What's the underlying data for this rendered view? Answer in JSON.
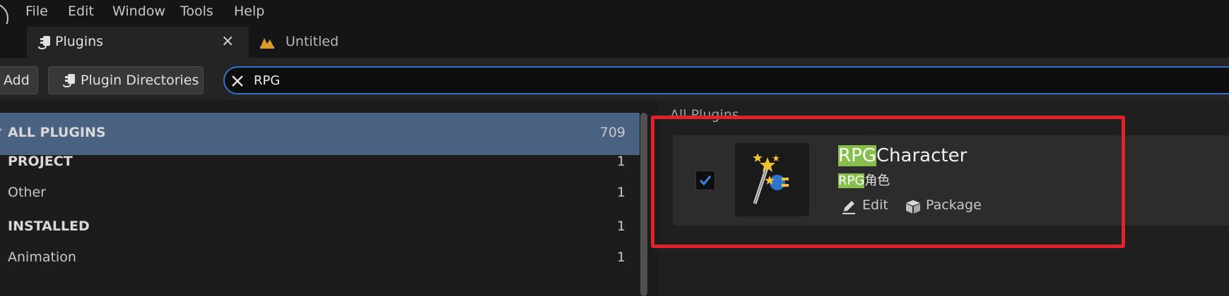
{
  "menu": {
    "items": [
      "File",
      "Edit",
      "Window",
      "Tools",
      "Help"
    ]
  },
  "tabs": [
    {
      "label": "Plugins",
      "close": "×",
      "icon": "plugin-icon"
    },
    {
      "label": "Untitled",
      "icon": "level-icon"
    }
  ],
  "toolbar": {
    "add_label": "Add",
    "directories_label": "Plugin Directories",
    "search": {
      "value": "RPG",
      "clear": "✕"
    }
  },
  "categories": [
    {
      "label": "ALL PLUGINS",
      "count": "709",
      "selected": true,
      "bold": true
    },
    {
      "label": "PROJECT",
      "count": "1",
      "bold": true
    },
    {
      "label": "Other",
      "count": "1"
    },
    {
      "label": "INSTALLED",
      "count": "1",
      "bold": true
    },
    {
      "label": "Animation",
      "count": "1"
    }
  ],
  "list": {
    "header": "All Plugins",
    "plugin": {
      "name_highlight": "RPG",
      "name_rest": "Character",
      "desc_highlight": "RPG",
      "desc_rest": "角色",
      "enabled": true,
      "edit_label": "Edit",
      "package_label": "Package",
      "icon": "magic-wand-plugin-icon"
    }
  },
  "colors": {
    "accent": "#2f73cc",
    "selection": "#4a6282",
    "highlight": "#86c04a",
    "annotation": "#e0232a"
  }
}
